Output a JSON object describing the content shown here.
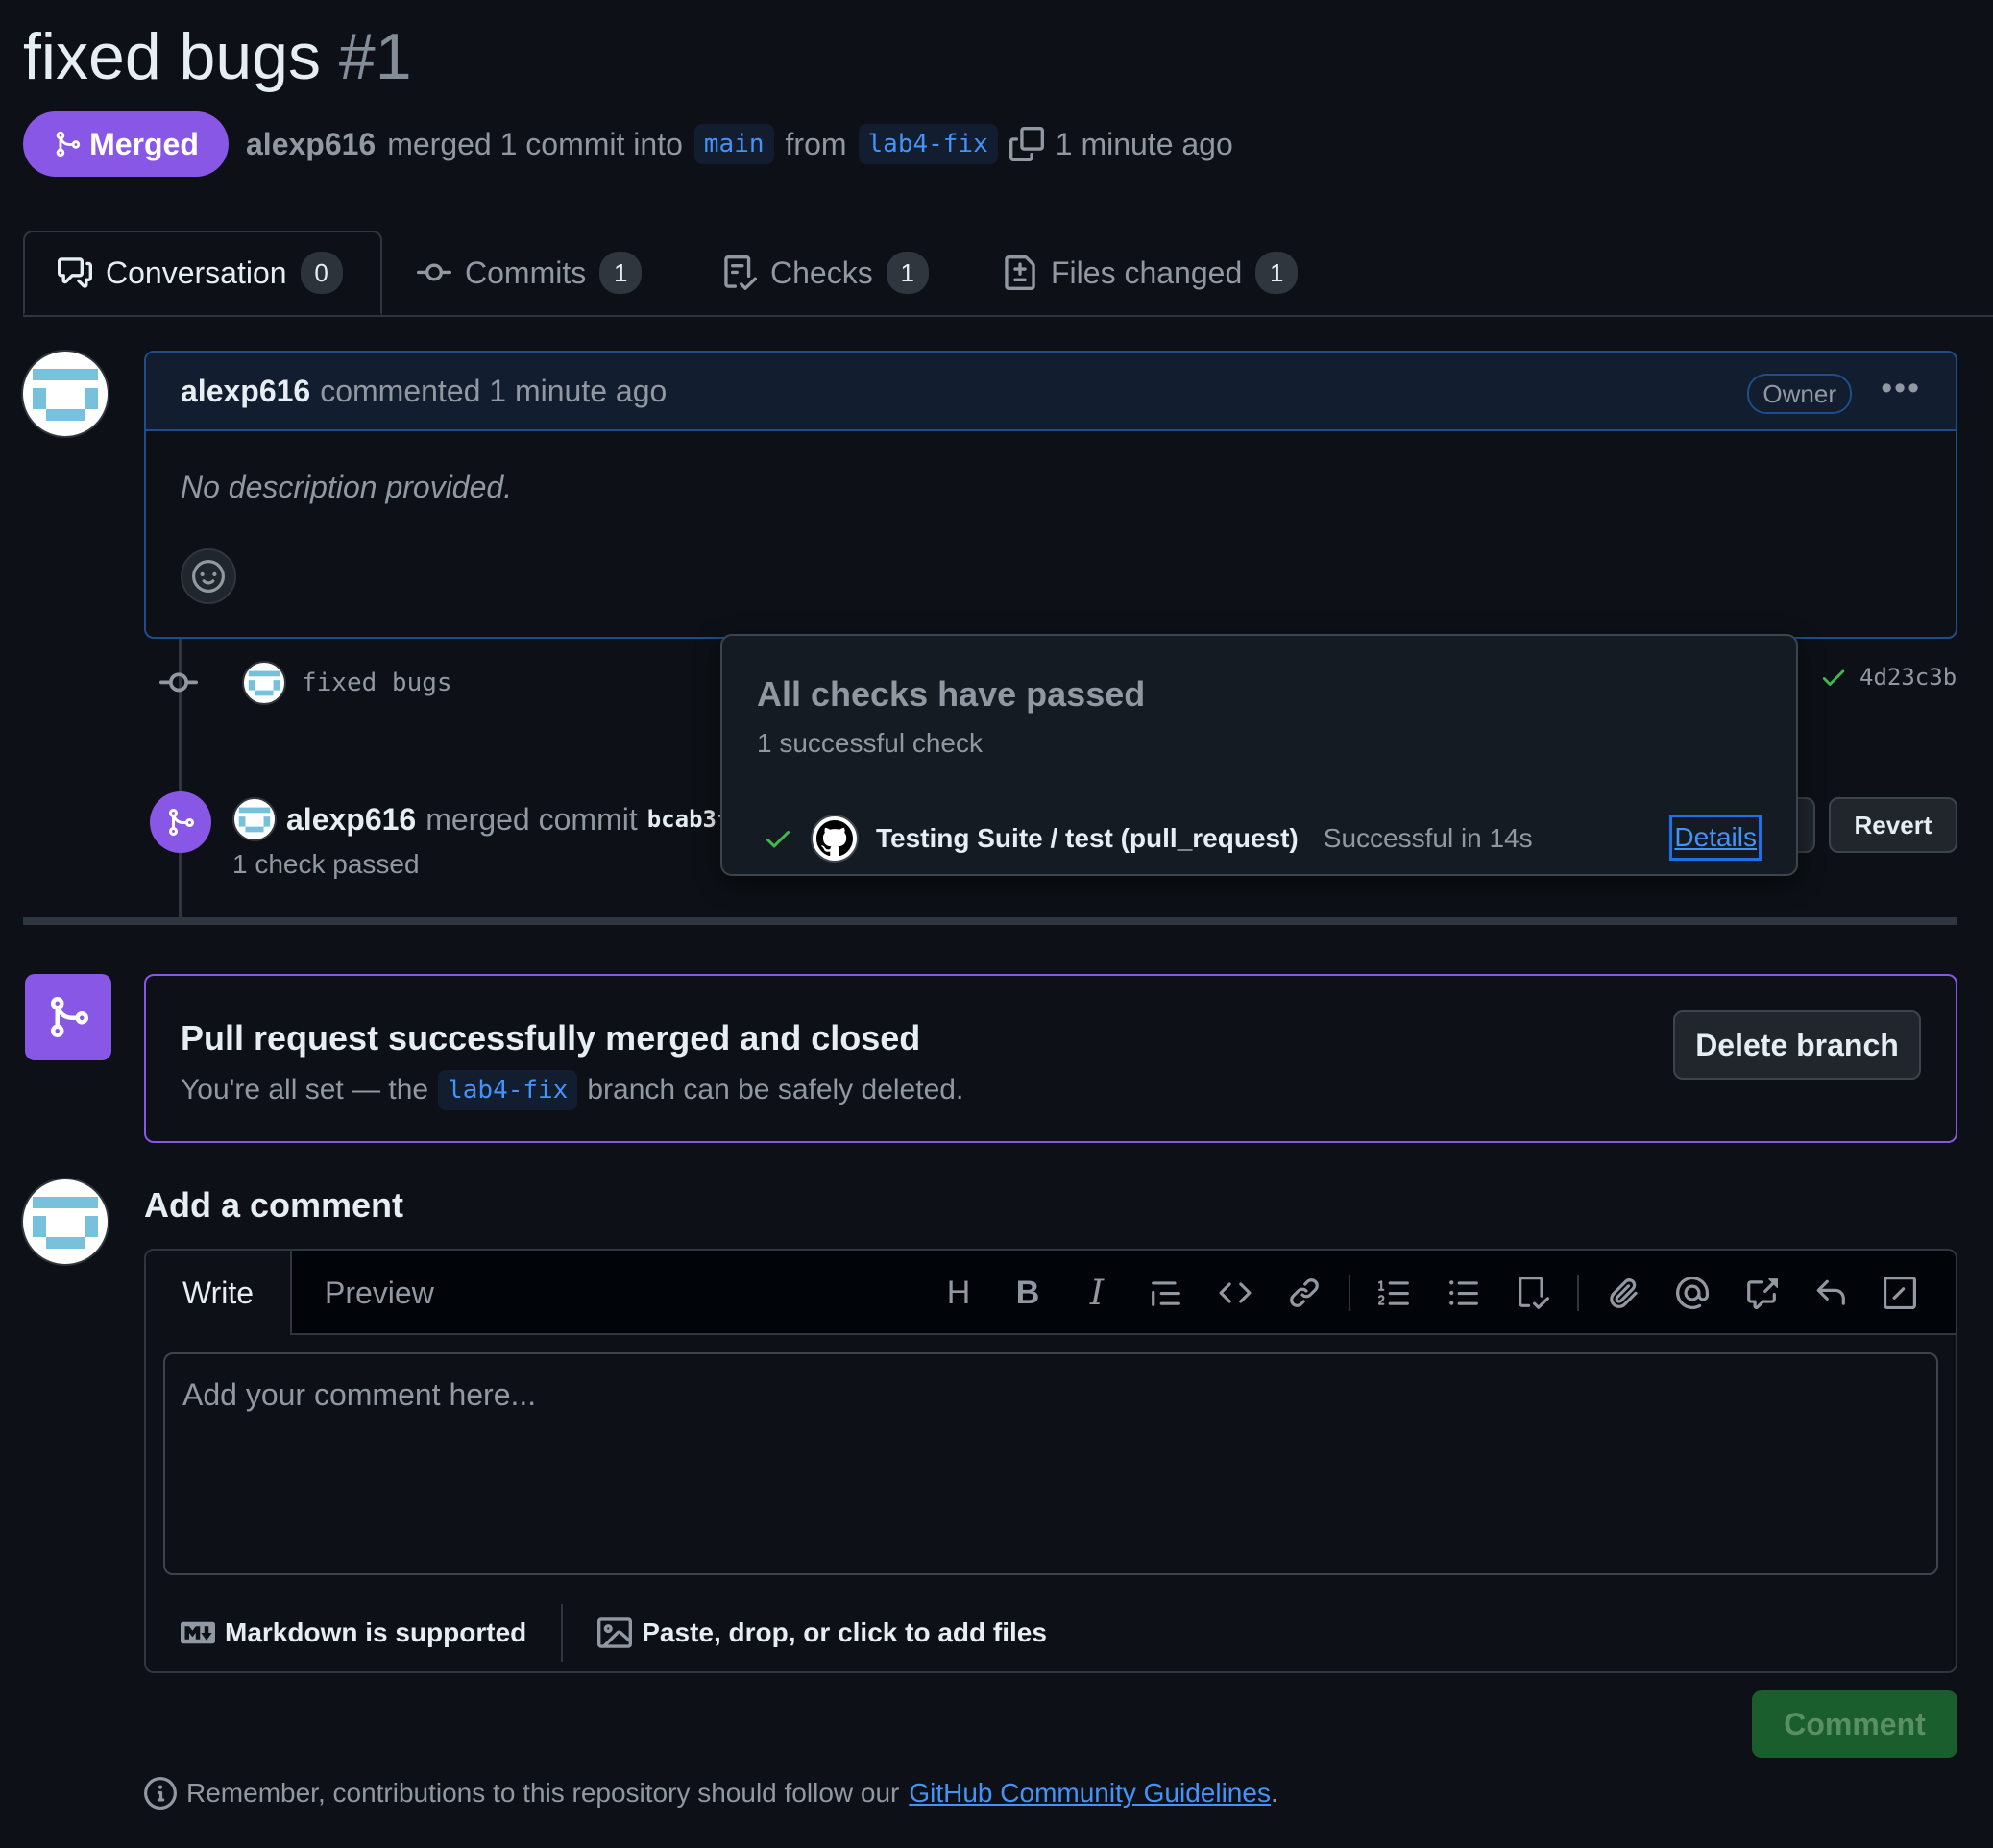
{
  "pr": {
    "title": "fixed bugs",
    "number": "#1",
    "state": "Merged",
    "author": "alexp616",
    "merge_text": "merged 1 commit into",
    "base_branch": "main",
    "from_text": "from",
    "head_branch": "lab4-fix",
    "time_ago": "1 minute ago"
  },
  "tabs": [
    {
      "label": "Conversation",
      "count": "0",
      "icon": "comment-discussion-icon"
    },
    {
      "label": "Commits",
      "count": "1",
      "icon": "git-commit-icon"
    },
    {
      "label": "Checks",
      "count": "1",
      "icon": "checklist-icon"
    },
    {
      "label": "Files changed",
      "count": "1",
      "icon": "file-diff-icon"
    }
  ],
  "comment": {
    "author": "alexp616",
    "action": "commented 1 minute ago",
    "role_badge": "Owner",
    "body": "No description provided."
  },
  "commit": {
    "message": "fixed bugs",
    "sha": "4d23c3b"
  },
  "merge_event": {
    "user": "alexp616",
    "text": "merged commit",
    "sha": "bcab3f",
    "checks_summary": "1 check passed",
    "revert_label": "Revert"
  },
  "checks_popover": {
    "title": "All checks have passed",
    "subtitle": "1 successful check",
    "check_name": "Testing Suite / test (pull_request)",
    "check_status": "Successful in 14s",
    "details_label": "Details"
  },
  "merged_box": {
    "title": "Pull request successfully merged and closed",
    "sub_before": "You're all set — the",
    "branch": "lab4-fix",
    "sub_after": "branch can be safely deleted.",
    "delete_label": "Delete branch"
  },
  "add_comment": {
    "title": "Add a comment",
    "write_tab": "Write",
    "preview_tab": "Preview",
    "placeholder": "Add your comment here...",
    "markdown_note": "Markdown is supported",
    "attach_note": "Paste, drop, or click to add files",
    "submit_label": "Comment"
  },
  "footer": {
    "text": "Remember, contributions to this repository should follow our",
    "link": "GitHub Community Guidelines",
    "end": "."
  },
  "colors": {
    "background": "#0d1117",
    "merged_purple": "#8957e5",
    "link_blue": "#4493f8",
    "success_green": "#3fb950",
    "comment_button": "#1a5e2e"
  }
}
